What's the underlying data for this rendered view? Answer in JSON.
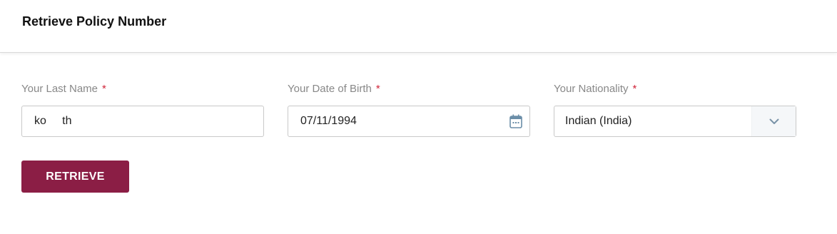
{
  "header": {
    "title": "Retrieve Policy Number"
  },
  "form": {
    "last_name": {
      "label": "Your Last Name",
      "required_mark": "*",
      "value": "ko     th"
    },
    "dob": {
      "label": "Your Date of Birth",
      "required_mark": "*",
      "value": "07/11/1994",
      "icon": "calendar-icon"
    },
    "nationality": {
      "label": "Your Nationality",
      "required_mark": "*",
      "value": "Indian (India)",
      "icon": "chevron-down-icon"
    },
    "retrieve_label": "RETRIEVE"
  },
  "colors": {
    "accent": "#8b1e45",
    "required": "#d0263a",
    "label": "#888888"
  }
}
